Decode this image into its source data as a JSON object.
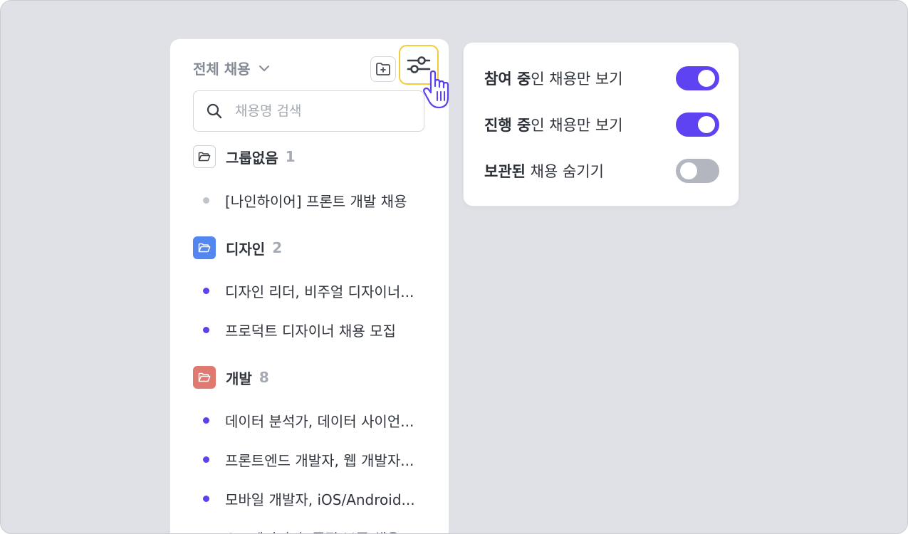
{
  "sidebar": {
    "scope_label": "전체 채용",
    "search_placeholder": "채용명 검색",
    "groups": [
      {
        "name": "그룹없음",
        "count": "1",
        "color": "none",
        "items": [
          "[나인하이어] 프론트 개발 채용"
        ]
      },
      {
        "name": "디자인",
        "count": "2",
        "color": "#5486f0",
        "items": [
          "디자인 리더, 비주얼 디자이너...",
          "프로덕트 디자이너 채용 모집"
        ]
      },
      {
        "name": "개발",
        "count": "8",
        "color": "#de7a6f",
        "items": [
          "데이터 분석가, 데이터 사이언...",
          "프론트엔드 개발자, 웹 개발자...",
          "모바일 개발자, iOS/Android...",
          "QA 엔지니어, 품질 보증 채용"
        ]
      }
    ]
  },
  "options": [
    {
      "strong": "참여 중",
      "rest": "인 채용만 보기",
      "enabled": true
    },
    {
      "strong": "진행 중",
      "rest": "인 채용만 보기",
      "enabled": true
    },
    {
      "strong": "보관된",
      "rest": " 채용 숨기기",
      "enabled": false
    }
  ],
  "colors": {
    "accent": "#5d43f1",
    "toggle_off": "#b1b6bf",
    "highlight_border": "#f2cc3c",
    "background": "#dfe1e6"
  }
}
